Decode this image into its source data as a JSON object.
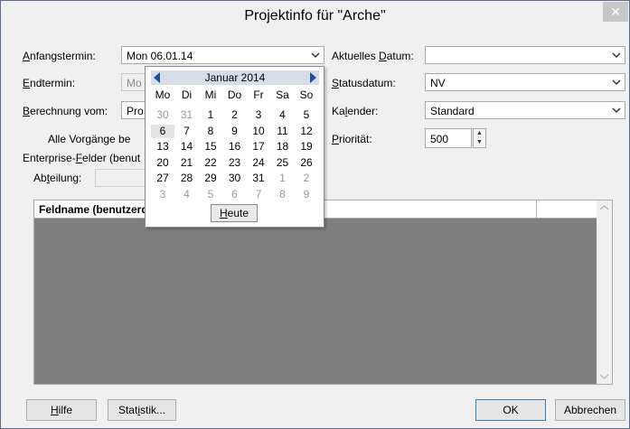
{
  "window": {
    "title": "Projektinfo für \"Arche\"",
    "close_glyph": "✕"
  },
  "left": {
    "start_label_u": "A",
    "start_label_rest": "nfangstermin:",
    "start_value": "Mon 06.01.14",
    "end_label_u": "E",
    "end_label_rest": "ndtermin:",
    "end_value": "Mo",
    "calc_label_u": "B",
    "calc_label_rest": "erechnung vom:",
    "calc_value": "Pro",
    "all_tasks_text": "Alle Vorgänge be",
    "enterprise_pre": "Enterprise-",
    "enterprise_u": "F",
    "enterprise_post": "elder (benut",
    "dept_pre": "Ab",
    "dept_u": "t",
    "dept_post": "eilung:"
  },
  "right": {
    "current_date_pre": "Aktuelles ",
    "current_date_u": "D",
    "current_date_post": "atum:",
    "current_date_value": "",
    "status_date_u": "S",
    "status_date_rest": "tatusdatum:",
    "status_date_value": "NV",
    "calendar_pre": "Ka",
    "calendar_u": "l",
    "calendar_post": "ender:",
    "calendar_value": "Standard",
    "priority_u": "P",
    "priority_rest": "riorität:",
    "priority_value": "500"
  },
  "grid": {
    "col1_header": "Feldname (benutzerd"
  },
  "calendar_popup": {
    "month_label": "Januar 2014",
    "weekdays": [
      "Mo",
      "Di",
      "Mi",
      "Do",
      "Fr",
      "Sa",
      "So"
    ],
    "weeks": [
      [
        {
          "d": "30",
          "o": true
        },
        {
          "d": "31",
          "o": true
        },
        {
          "d": "1"
        },
        {
          "d": "2"
        },
        {
          "d": "3"
        },
        {
          "d": "4"
        },
        {
          "d": "5"
        }
      ],
      [
        {
          "d": "6",
          "sel": true
        },
        {
          "d": "7"
        },
        {
          "d": "8"
        },
        {
          "d": "9"
        },
        {
          "d": "10"
        },
        {
          "d": "11"
        },
        {
          "d": "12"
        }
      ],
      [
        {
          "d": "13"
        },
        {
          "d": "14"
        },
        {
          "d": "15"
        },
        {
          "d": "16"
        },
        {
          "d": "17"
        },
        {
          "d": "18"
        },
        {
          "d": "19"
        }
      ],
      [
        {
          "d": "20"
        },
        {
          "d": "21"
        },
        {
          "d": "22"
        },
        {
          "d": "23"
        },
        {
          "d": "24"
        },
        {
          "d": "25"
        },
        {
          "d": "26"
        }
      ],
      [
        {
          "d": "27"
        },
        {
          "d": "28"
        },
        {
          "d": "29"
        },
        {
          "d": "30"
        },
        {
          "d": "31"
        },
        {
          "d": "1",
          "o": true
        },
        {
          "d": "2",
          "o": true
        }
      ],
      [
        {
          "d": "3",
          "o": true
        },
        {
          "d": "4",
          "o": true
        },
        {
          "d": "5",
          "o": true
        },
        {
          "d": "6",
          "o": true
        },
        {
          "d": "7",
          "o": true
        },
        {
          "d": "8",
          "o": true
        },
        {
          "d": "9",
          "o": true
        }
      ]
    ],
    "today_u": "H",
    "today_rest": "eute"
  },
  "buttons": {
    "help_u": "H",
    "help_rest": "ilfe",
    "stats_pre": "Stat",
    "stats_u": "i",
    "stats_post": "stik...",
    "ok": "OK",
    "cancel": "Abbrechen"
  },
  "colors": {
    "accent": "#1e4f9c",
    "popup_header": "#d7dde8",
    "grid_bg": "#7f7f7f",
    "other_month": "#9a9a9a"
  }
}
